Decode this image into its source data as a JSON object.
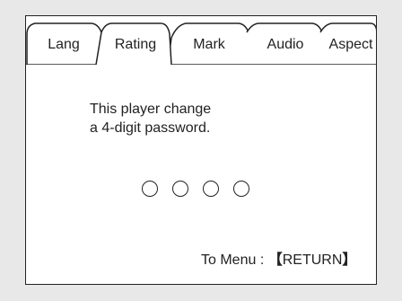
{
  "tabs": [
    {
      "label": "Lang"
    },
    {
      "label": "Rating"
    },
    {
      "label": "Mark"
    },
    {
      "label": "Audio"
    },
    {
      "label": "Aspect"
    }
  ],
  "active_tab": "Rating",
  "message": {
    "line1": "This player change",
    "line2": "a 4-digit password."
  },
  "password": {
    "digits": 4,
    "entered": 0
  },
  "footer": {
    "prefix": "To Menu : ",
    "bracket_open": "【",
    "key": "RETURN",
    "bracket_close": "】"
  },
  "colors": {
    "background": "#e8e8e8",
    "panel": "#ffffff",
    "line": "#222222"
  }
}
